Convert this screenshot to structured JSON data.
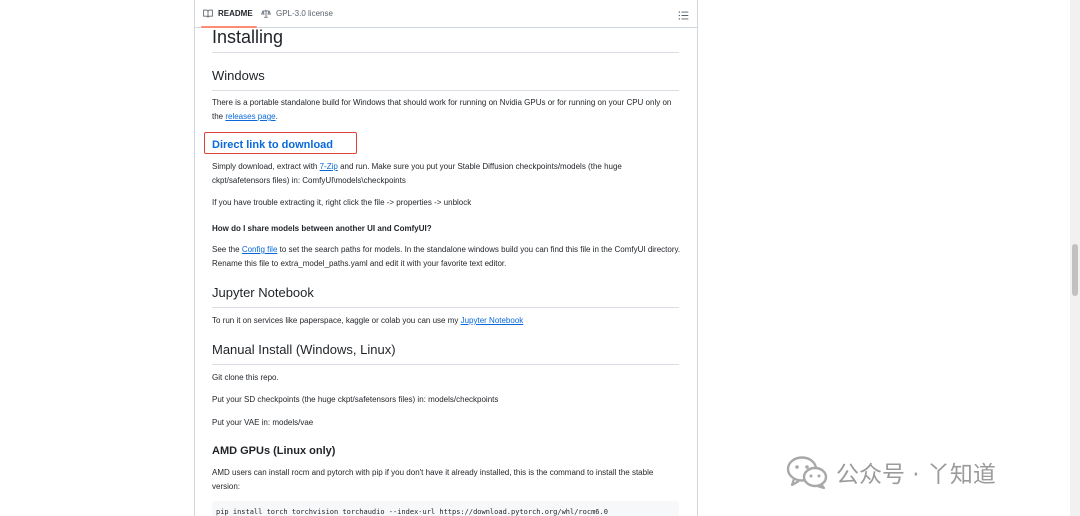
{
  "tabs": {
    "readme_label": "README",
    "license_label": "GPL-3.0 license"
  },
  "readme": {
    "installing_heading": "Installing",
    "windows_heading": "Windows",
    "windows_text_1": "There is a portable standalone build for Windows that should work for running on Nvidia GPUs or for running on your CPU only on the ",
    "releases_link": "releases page",
    "windows_text_1_end": ".",
    "direct_link": "Direct link to download",
    "extract_text_1": "Simply download, extract with ",
    "sevenzip_link": "7-Zip",
    "extract_text_2": " and run. Make sure you put your Stable Diffusion checkpoints/models (the huge ckpt/safetensors files) in: ComfyUI\\models\\checkpoints",
    "trouble_text": "If you have trouble extracting it, right click the file -> properties -> unblock",
    "share_heading": "How do I share models between another UI and ComfyUI?",
    "config_text_1": "See the ",
    "config_link": "Config file",
    "config_text_2": " to set the search paths for models. In the standalone windows build you can find this file in the ComfyUI directory. Rename this file to extra_model_paths.yaml and edit it with your favorite text editor.",
    "jupyter_heading": "Jupyter Notebook",
    "jupyter_text": "To run it on services like paperspace, kaggle or colab you can use my ",
    "jupyter_link": "Jupyter Notebook",
    "manual_heading": "Manual Install (Windows, Linux)",
    "git_clone_text": "Git clone this repo.",
    "checkpoints_text": "Put your SD checkpoints (the huge ckpt/safetensors files) in: models/checkpoints",
    "vae_text": "Put your VAE in: models/vae",
    "amd_heading": "AMD GPUs (Linux only)",
    "amd_text": "AMD users can install rocm and pytorch with pip if you don't have it already installed, this is the command to install the stable version:",
    "pip_command": "pip install torch torchvision torchaudio --index-url https://download.pytorch.org/whl/rocm6.0"
  },
  "watermark": {
    "text": "公众号 · 丫知道",
    "icon": "wechat-icon"
  },
  "colors": {
    "link": "#0969da",
    "highlight_border": "#e0443a",
    "tab_underline": "#fd8c73"
  }
}
